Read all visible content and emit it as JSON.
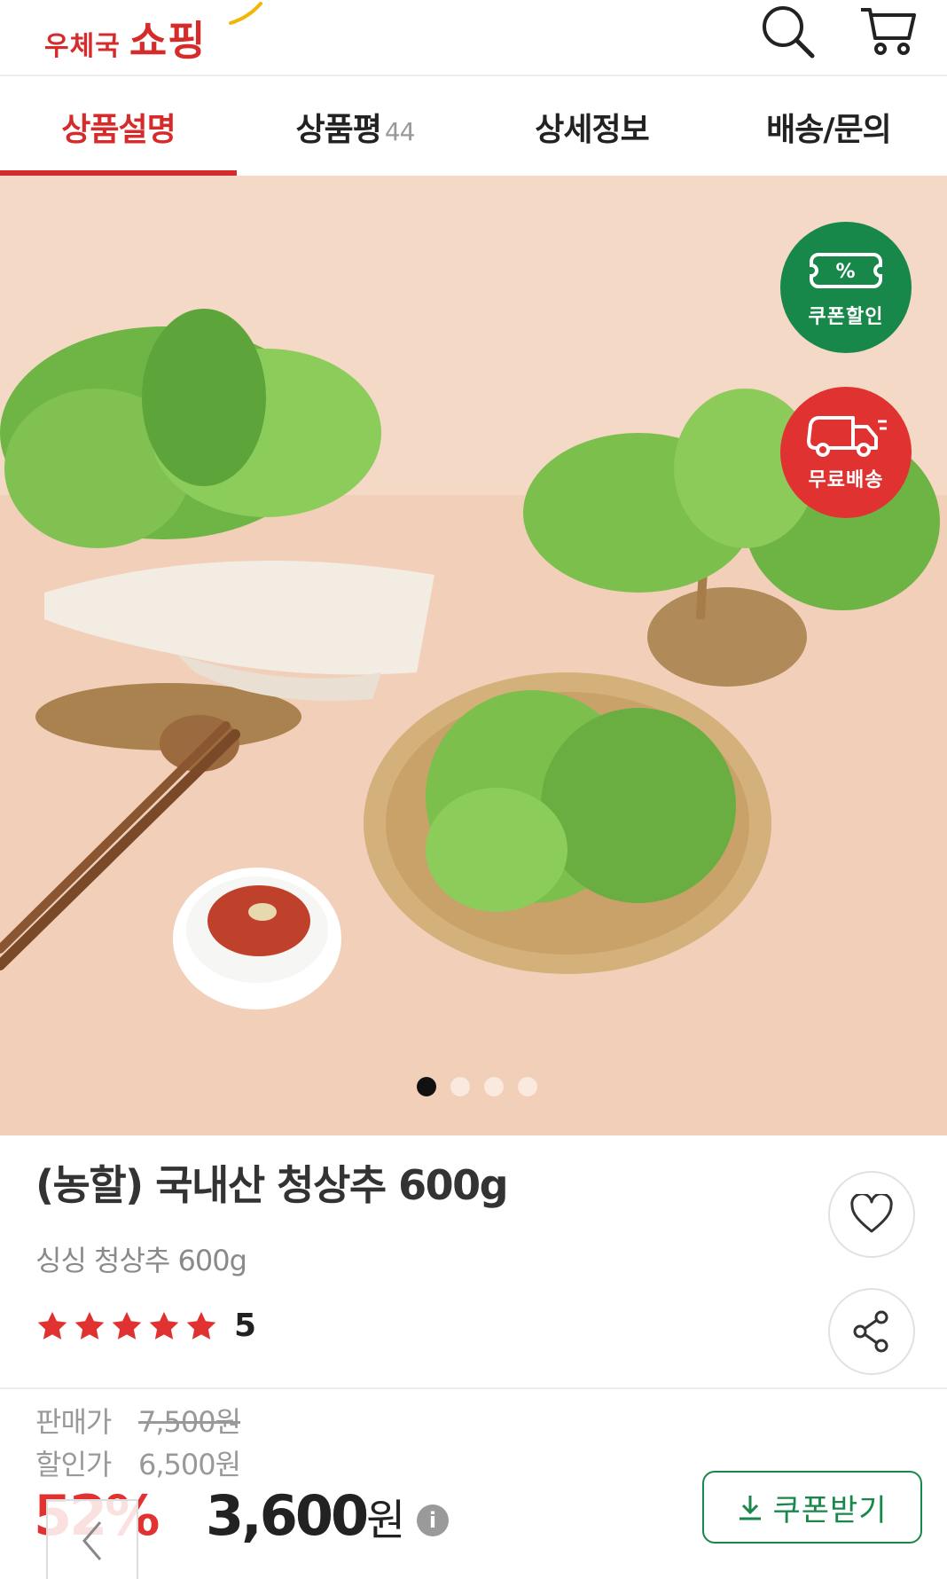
{
  "header": {
    "logo_prefix": "우체국",
    "logo_main": "쇼핑",
    "search_icon": "search-icon",
    "cart_icon": "cart-icon"
  },
  "tabs": [
    {
      "label": "상품설명",
      "active": true
    },
    {
      "label": "상품평",
      "count": "44",
      "active": false
    },
    {
      "label": "상세정보",
      "active": false
    },
    {
      "label": "배송/문의",
      "active": false
    }
  ],
  "hero": {
    "badges": {
      "coupon": {
        "label": "쿠폰할인",
        "symbol": "%",
        "color": "#17874a"
      },
      "free_shipping": {
        "label": "무료배송",
        "color": "#e13232"
      }
    },
    "carousel": {
      "total": 4,
      "active_index": 1
    }
  },
  "product": {
    "title": "(농할) 국내산 청상추 600g",
    "subtitle": "싱싱 청상추 600g",
    "rating": {
      "value": "5",
      "stars": 5
    }
  },
  "price": {
    "sale_label": "판매가",
    "sale_value": "7,500원",
    "discount_label": "할인가",
    "discount_value": "6,500원",
    "final_percent": "52%",
    "final_amount": "3,600",
    "final_unit": "원",
    "info_glyph": "i"
  },
  "coupon_button": {
    "label": "쿠폰받기"
  },
  "colors": {
    "brand_red": "#d52b2b",
    "green": "#17874a"
  }
}
